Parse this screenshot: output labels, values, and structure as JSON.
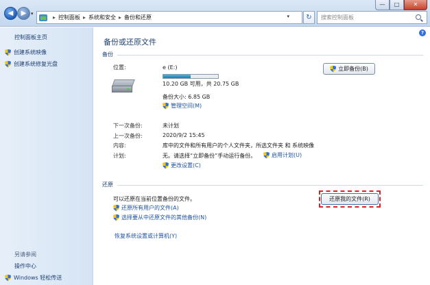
{
  "window": {
    "minimize": "—",
    "maximize": "□",
    "close": "✕"
  },
  "address": {
    "crumbs": [
      "控制面板",
      "系统和安全",
      "备份和还原"
    ],
    "separator": "▸",
    "search_placeholder": "搜索控制面板"
  },
  "left_pane": {
    "home": "控制面板主页",
    "tasks": [
      "创建系统映像",
      "创建系统修复光盘"
    ],
    "see_also": "另请参阅",
    "links": [
      "操作中心",
      "Windows 轻松传送"
    ]
  },
  "main": {
    "title": "备份或还原文件",
    "backup_section": "备份",
    "location_label": "位置:",
    "location_value": "e (E:)",
    "drive_used_fraction": 0.5,
    "free_space": "10.20 GB 可用，共 20.75 GB",
    "backup_size": "备份大小: 6.85 GB",
    "manage_space": "管理空间(M)",
    "next_label": "下一次备份:",
    "next_value": "未计划",
    "last_label": "上一次备份:",
    "last_value": "2020/9/2 15:45",
    "contents_label": "内容:",
    "contents_value": "库中的文件和所有用户的个人文件夹，所选文件夹 和 系统映像",
    "schedule_label": "计划:",
    "schedule_value": "无。请选择“立即备份”手动运行备份。",
    "enable_schedule": "启用计划(U)",
    "change_settings": "更改设置(C)",
    "backup_now": "立即备份(B)",
    "restore_section": "还原",
    "restore_desc": "可以还原在当前位置备份的文件。",
    "restore_all_users": "还原所有用户的文件(A)",
    "select_other": "选择要从中还原文件的其他备份(N)",
    "restore_my_files": "还原我的文件(R)",
    "recover_system": "恢复系统设置或计算机(Y)"
  }
}
